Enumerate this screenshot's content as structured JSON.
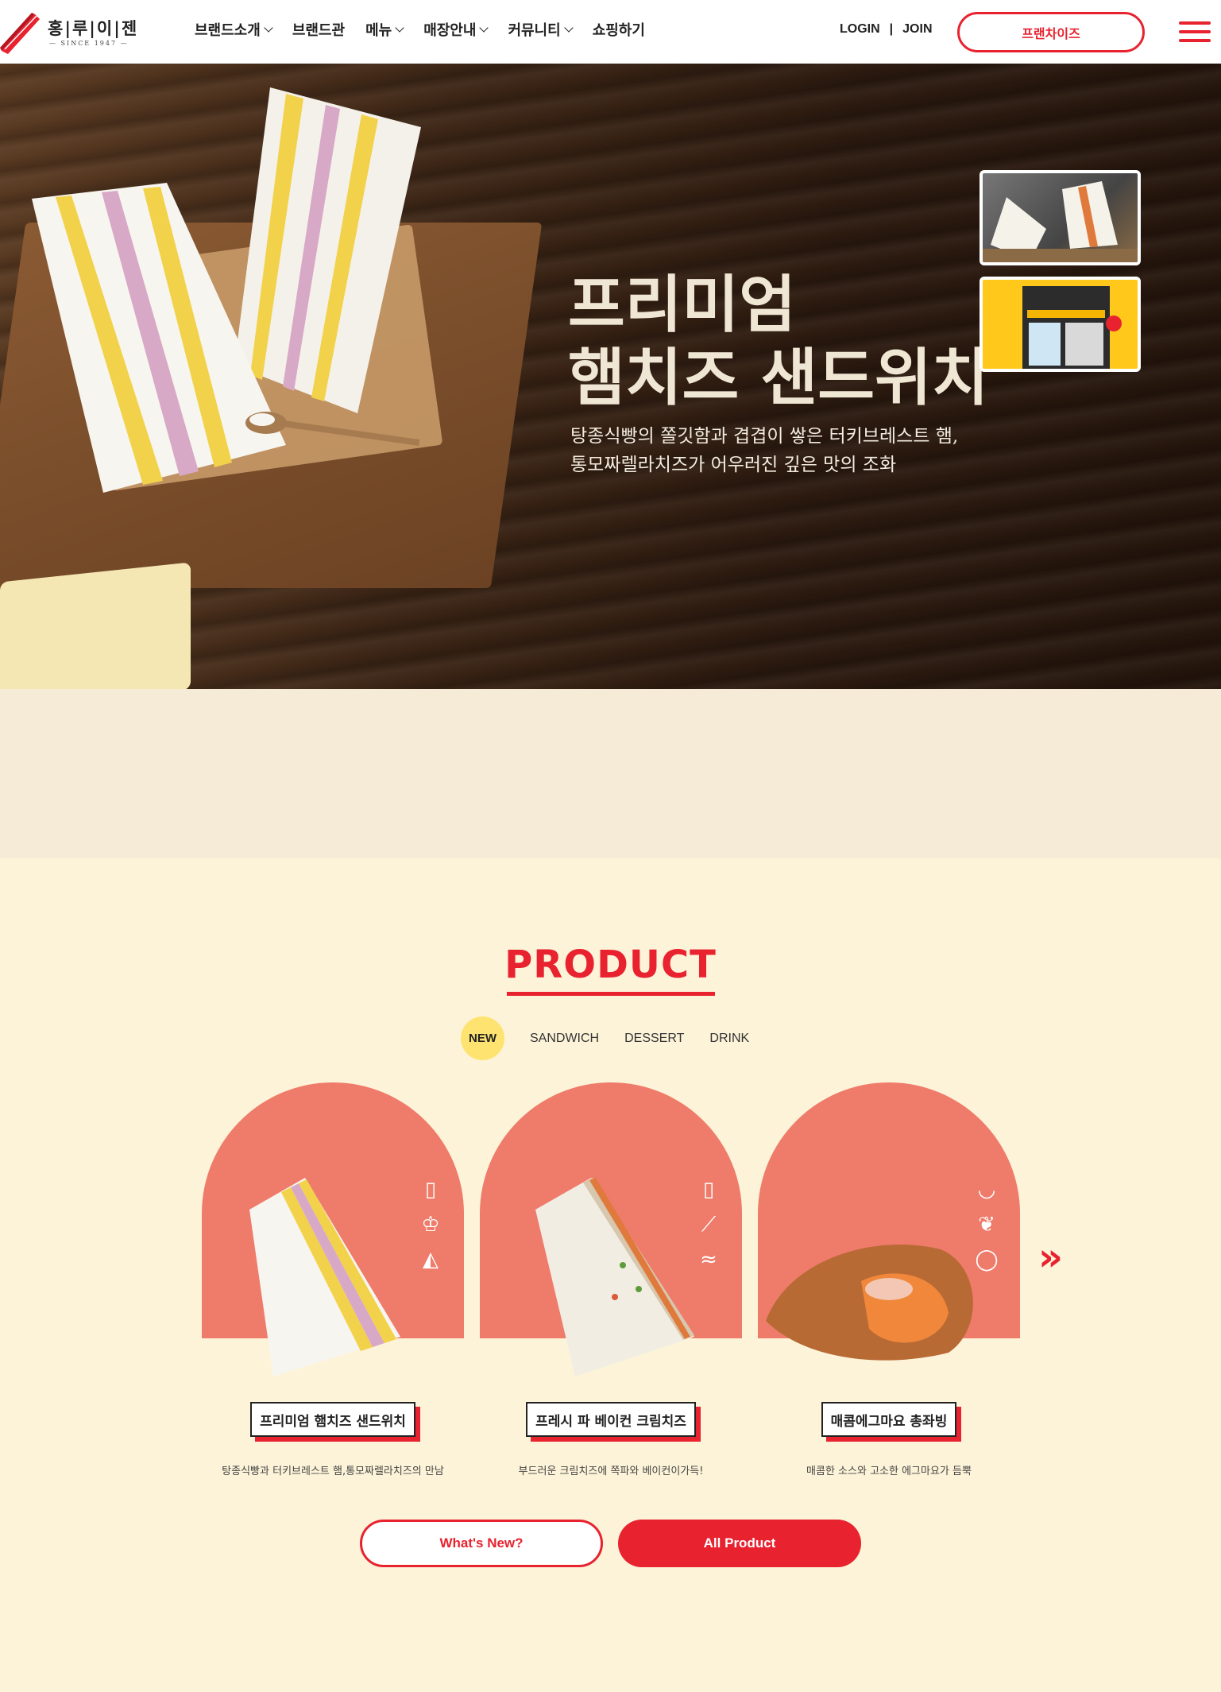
{
  "brand": {
    "name": "홍|루|이|젠",
    "since": "SINCE 1947"
  },
  "nav": {
    "items": [
      {
        "label": "브랜드소개",
        "has_dropdown": true
      },
      {
        "label": "브랜드관",
        "has_dropdown": false
      },
      {
        "label": "메뉴",
        "has_dropdown": true
      },
      {
        "label": "매장안내",
        "has_dropdown": true
      },
      {
        "label": "커뮤니티",
        "has_dropdown": true
      },
      {
        "label": "쇼핑하기",
        "has_dropdown": false
      }
    ]
  },
  "auth": {
    "login": "LOGIN",
    "separator": "|",
    "join": "JOIN"
  },
  "header": {
    "franchise": "프랜차이즈"
  },
  "hero": {
    "title_line1": "프리미엄",
    "title_line2": "햄치즈 샌드위치",
    "sub_line1": "탕종식빵의 쫄깃함과 겹겹이 쌓은 터키브레스트 햄,",
    "sub_line2": "통모짜렐라치즈가 어우러진 깊은 맛의 조화"
  },
  "product": {
    "title": "PRODUCT",
    "tabs": [
      "NEW",
      "SANDWICH",
      "DESSERT",
      "DRINK"
    ],
    "active_tab": "NEW",
    "cards": [
      {
        "name": "프리미엄 햄치즈 샌드위치",
        "desc": "탕종식빵과 터키브레스트 햄,통모짜렐라치즈의 만남",
        "icons": [
          "bread-icon",
          "crown-icon",
          "cheese-icon"
        ]
      },
      {
        "name": "프레시 파 베이컨 크림치즈",
        "desc": "부드러운 크림치즈에 쪽파와 베이컨이가득!",
        "icons": [
          "bread-icon",
          "green-onion-icon",
          "bacon-icon"
        ]
      },
      {
        "name": "매콤에그마요 총좌빙",
        "desc": "매콤한 소스와 고소한 에그마요가 듬뿍",
        "icons": [
          "plate-icon",
          "chili-icon",
          "egg-icon"
        ]
      }
    ],
    "buttons": {
      "whats_new": "What's New?",
      "all_product": "All Product"
    }
  },
  "colors": {
    "accent": "#e8222f",
    "arch": "#ef7b6a",
    "tab_active": "#ffe370",
    "bg": "#fdf3d8",
    "band": "#f6ebd6"
  }
}
